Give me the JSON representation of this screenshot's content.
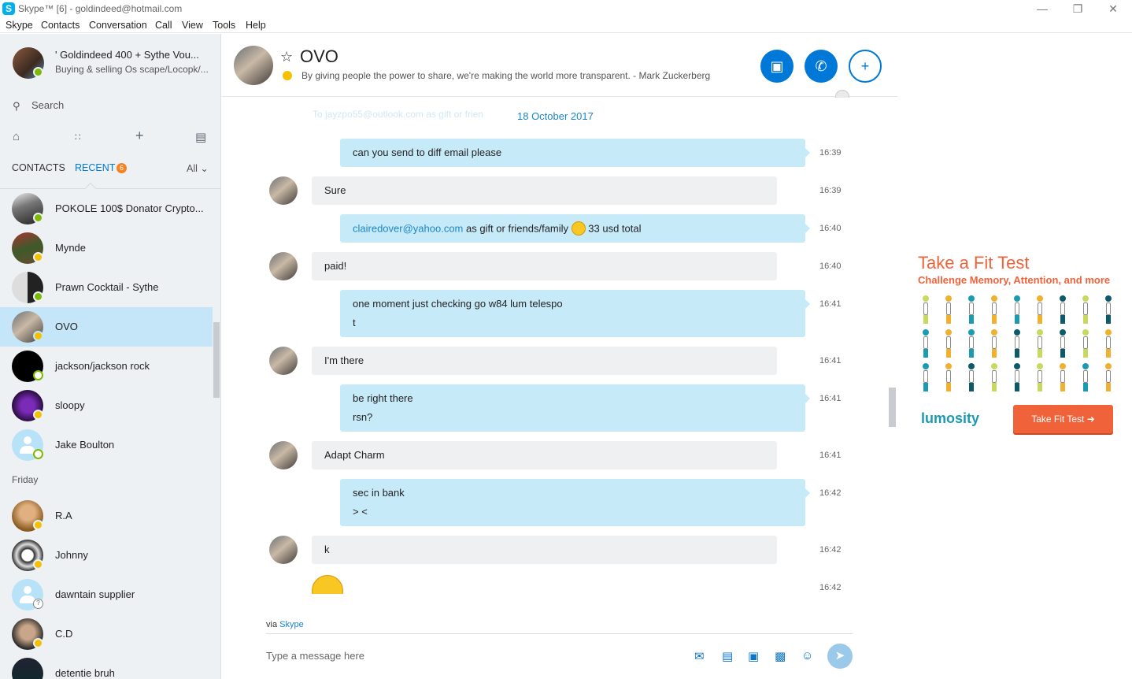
{
  "window": {
    "title": "Skype™ [6] - goldindeed@hotmail.com",
    "minimize": "—",
    "restore": "❐",
    "close": "✕"
  },
  "menu": [
    "Skype",
    "Contacts",
    "Conversation",
    "Call",
    "View",
    "Tools",
    "Help"
  ],
  "profile": {
    "name": "' Goldindeed 400 + Sythe Vou...",
    "mood": "Buying & selling Os scape/Locopk/..."
  },
  "search": {
    "placeholder": "Search"
  },
  "tabs": {
    "contacts": "CONTACTS",
    "recent": "RECENT",
    "recent_count": "6",
    "filter": "All"
  },
  "contacts": [
    {
      "name": "POKOLE 100$ Donator Crypto...",
      "status": "online"
    },
    {
      "name": "Mynde",
      "status": "away"
    },
    {
      "name": "Prawn Cocktail - Sythe",
      "status": "online"
    },
    {
      "name": "OVO",
      "status": "away",
      "selected": true
    },
    {
      "name": "jackson/jackson rock",
      "status": "offline"
    },
    {
      "name": "sloopy",
      "status": "away"
    },
    {
      "name": "Jake Boulton",
      "status": "offline"
    }
  ],
  "section_friday": "Friday",
  "contacts_friday": [
    {
      "name": "R.A",
      "status": "away"
    },
    {
      "name": "Johnny",
      "status": "away"
    },
    {
      "name": "dawntain supplier",
      "status": "unknown"
    },
    {
      "name": "C.D",
      "status": "away"
    },
    {
      "name": "detentie bruh",
      "status": "away"
    }
  ],
  "conversation": {
    "name": "OVO",
    "mood": "By giving people the power to share, we're making the world more transparent. - Mark Zuckerberg",
    "date": "18 October 2017",
    "faded_text": "To jayzpo55@outlook.com  as gift or frien",
    "messages": [
      {
        "dir": "out",
        "lines": [
          "can you send to diff email please"
        ],
        "time": "16:39"
      },
      {
        "dir": "in",
        "lines": [
          "Sure"
        ],
        "time": "16:39"
      },
      {
        "dir": "out",
        "link": "clairedover@yahoo.com",
        "text_after": " as gift or friends/family ",
        "text_end": " 33 usd total",
        "time": "16:40"
      },
      {
        "dir": "in",
        "lines": [
          "paid!"
        ],
        "time": "16:40"
      },
      {
        "dir": "out",
        "lines": [
          "one moment just checking go w84 lum telespo",
          "t"
        ],
        "time": "16:41"
      },
      {
        "dir": "in",
        "lines": [
          "I'm there"
        ],
        "time": "16:41"
      },
      {
        "dir": "out",
        "lines": [
          "be right there",
          "rsn?"
        ],
        "time": "16:41"
      },
      {
        "dir": "in",
        "lines": [
          "Adapt Charm"
        ],
        "time": "16:41"
      },
      {
        "dir": "out",
        "lines": [
          "sec in bank",
          "> <"
        ],
        "time": "16:42"
      },
      {
        "dir": "in",
        "lines": [
          "k"
        ],
        "time": "16:42"
      },
      {
        "dir": "in",
        "emoji": true,
        "time": "16:42"
      }
    ],
    "via_prefix": "via ",
    "via_link": "Skype",
    "input_placeholder": "Type a message here"
  },
  "ad": {
    "title": "Take a Fit Test",
    "subtitle": "Challenge Memory, Attention, and more",
    "logo": "lumosity",
    "button": "Take Fit Test ➜"
  },
  "colors": {
    "accent": "#0078d7",
    "bubble_out": "#c7eaf9",
    "bubble_in": "#eef0f2",
    "ad_orange": "#f0633a",
    "ad_teal": "#1b9bb0"
  }
}
